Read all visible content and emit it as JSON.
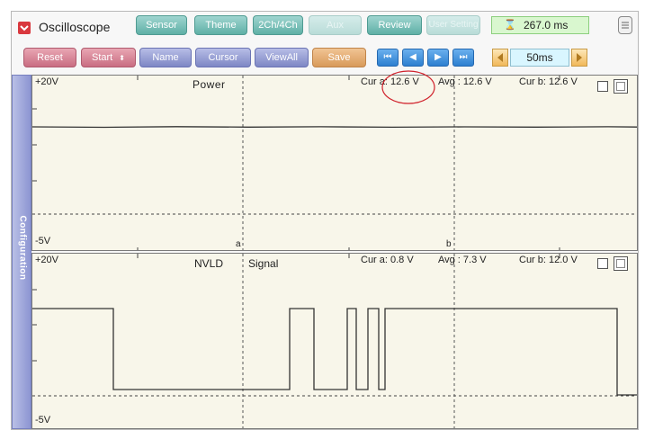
{
  "app": {
    "title": "Oscilloscope"
  },
  "toolbar": {
    "tabs": [
      "Sensor",
      "Theme",
      "2Ch/4Ch",
      "Aux",
      "Review",
      "User Setting"
    ],
    "time_value": "267.0 ms",
    "buttons": {
      "reset": "Reset",
      "start": "Start",
      "name": "Name",
      "cursor": "Cursor",
      "viewall": "ViewAll",
      "save": "Save"
    },
    "timebase": "50ms"
  },
  "sidebar": {
    "label": "Configuration"
  },
  "channels": [
    {
      "ymax": "+20V",
      "ymin": "-5V",
      "name": "Power",
      "cur_a": "Cur a: 12.6 V",
      "avg": "Avg : 12.6 V",
      "cur_b": "Cur b: 12.6 V"
    },
    {
      "ymax": "+20V",
      "ymin": "-5V",
      "name_left": "NVLD",
      "name_right": "Signal",
      "cur_a": "Cur a: 0.8 V",
      "avg": "Avg : 7.3 V",
      "cur_b": "Cur b: 12.0 V"
    }
  ],
  "cursors": {
    "a": "a",
    "b": "b"
  },
  "colors": {
    "annotation": "#d0202a",
    "plot_bg": "#f8f6ea"
  }
}
